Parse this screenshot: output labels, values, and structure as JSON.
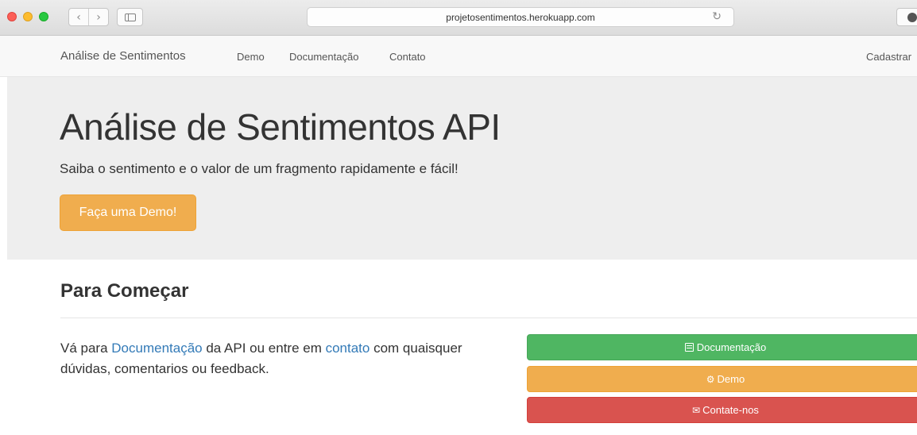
{
  "browser": {
    "url": "projetosentimentos.herokuapp.com",
    "icons": [
      "close-icon",
      "minimize-icon",
      "maximize-icon",
      "back-icon",
      "forward-icon",
      "sidebar-icon",
      "reload-icon",
      "download-icon"
    ]
  },
  "navbar": {
    "brand": "Análise de Sentimentos",
    "links": [
      "Demo",
      "Documentação",
      "Contato"
    ],
    "right_link": "Cadastrar"
  },
  "jumbotron": {
    "title": "Análise de Sentimentos API",
    "subtitle": "Saiba o sentimento e o valor de um fragmento rapidamente e fácil!",
    "cta": "Faça uma Demo!"
  },
  "section": {
    "title": "Para Começar",
    "text_before_doc": "Vá para ",
    "doc_link": "Documentação",
    "text_middle": " da API ou entre em ",
    "contact_link": "contato",
    "text_after": " com quaisquer dúvidas, comentarios ou feedback."
  },
  "buttons": {
    "documentation": "Documentação",
    "demo": "Demo",
    "contact": "Contate-nos"
  },
  "colors": {
    "success": "#4fb662",
    "warning": "#f0ad4e",
    "danger": "#d9534f",
    "link": "#337ab7"
  }
}
